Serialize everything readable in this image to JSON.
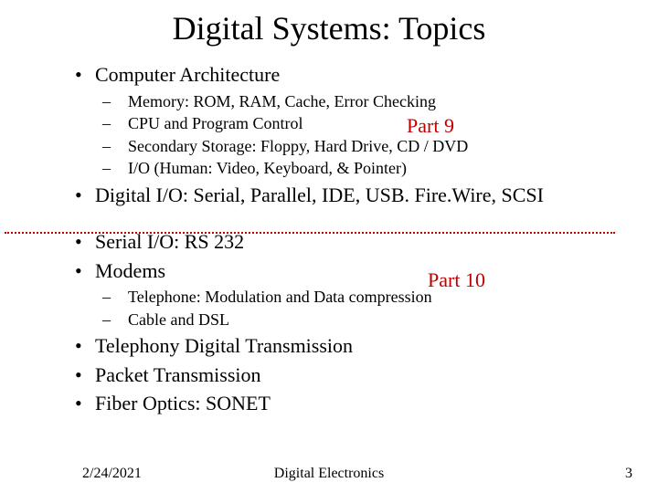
{
  "title": "Digital Systems: Topics",
  "bullets": {
    "b1": "Computer Architecture",
    "b1_sub": [
      "Memory: ROM, RAM, Cache, Error Checking",
      "CPU and Program Control",
      "Secondary Storage: Floppy, Hard Drive, CD / DVD",
      "I/O (Human: Video, Keyboard, & Pointer)"
    ],
    "b2": "Digital I/O: Serial, Parallel, IDE, USB. Fire.Wire, SCSI",
    "b3": "Serial I/O: RS 232",
    "b4": "Modems",
    "b4_sub": [
      "Telephone: Modulation and Data compression",
      "Cable and DSL"
    ],
    "b5": "Telephony Digital Transmission",
    "b6": "Packet Transmission",
    "b7": "Fiber Optics: SONET"
  },
  "annotations": {
    "part9": "Part 9",
    "part10": "Part 10"
  },
  "footer": {
    "date": "2/24/2021",
    "center": "Digital Electronics",
    "page": "3"
  }
}
